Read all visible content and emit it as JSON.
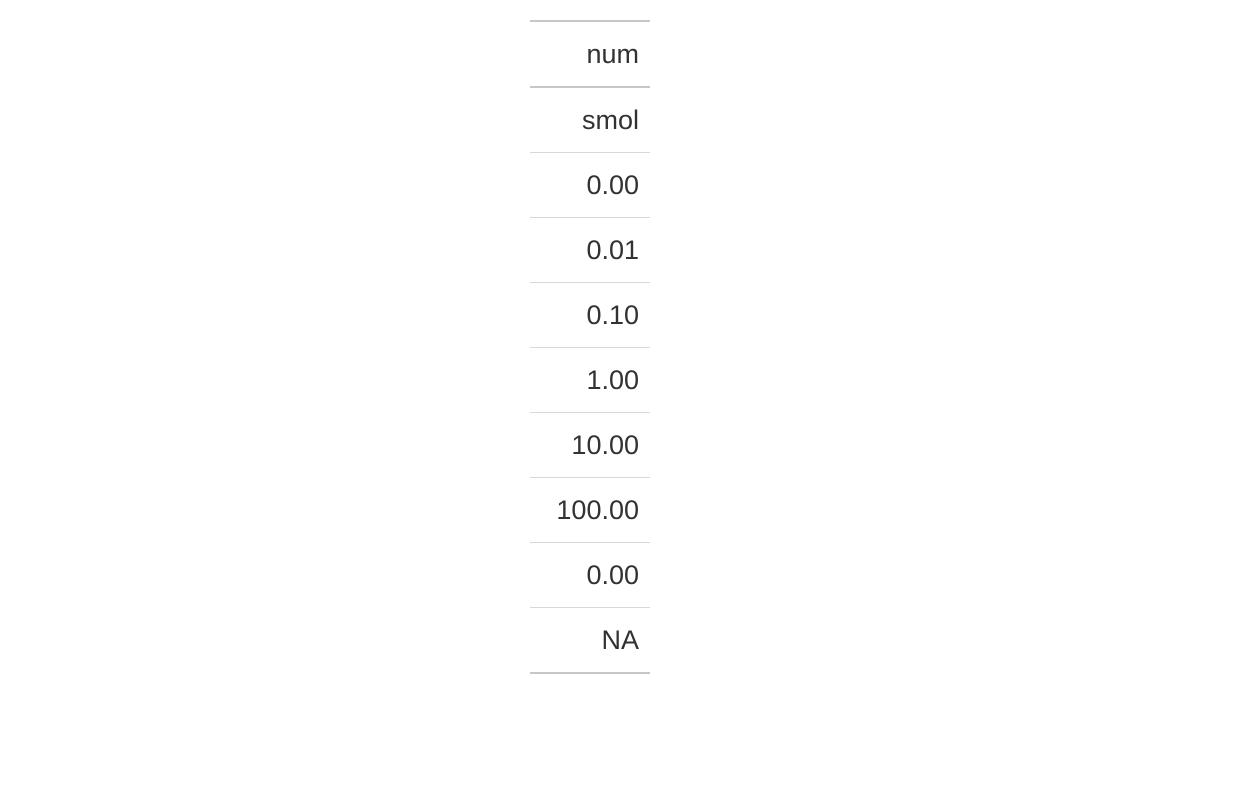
{
  "chart_data": {
    "type": "table",
    "columns": [
      "num"
    ],
    "sub_columns": [
      "smol"
    ],
    "rows": [
      [
        "0.00"
      ],
      [
        "0.01"
      ],
      [
        "0.10"
      ],
      [
        "1.00"
      ],
      [
        "10.00"
      ],
      [
        "100.00"
      ],
      [
        "0.00"
      ],
      [
        "NA"
      ]
    ]
  }
}
